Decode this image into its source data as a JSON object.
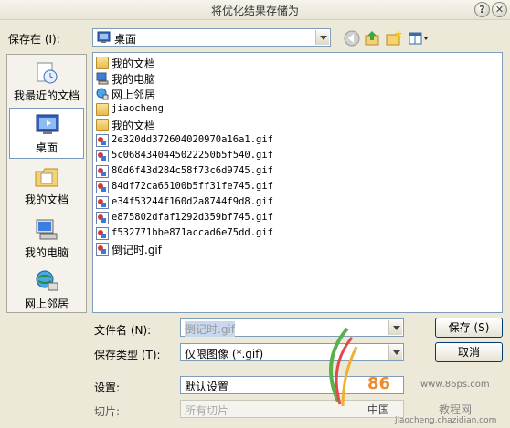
{
  "window": {
    "title": "将优化结果存储为",
    "help_glyph": "?",
    "close_glyph": "✕"
  },
  "toolbar": {
    "save_in_label": "保存在 (I):",
    "location_value": "桌面",
    "icons": [
      "back-icon",
      "up-folder-icon",
      "new-folder-icon",
      "view-menu-icon"
    ]
  },
  "places": [
    {
      "label": "我最近的文档",
      "icon": "recent-documents-icon"
    },
    {
      "label": "桌面",
      "icon": "desktop-icon",
      "selected": true
    },
    {
      "label": "我的文档",
      "icon": "my-documents-icon"
    },
    {
      "label": "我的电脑",
      "icon": "my-computer-icon"
    },
    {
      "label": "网上邻居",
      "icon": "network-places-icon"
    }
  ],
  "files": [
    {
      "name": "我的文档",
      "icon": "documents-folder-icon"
    },
    {
      "name": "我的电脑",
      "icon": "computer-icon"
    },
    {
      "name": "网上邻居",
      "icon": "network-icon"
    },
    {
      "name": "jiaocheng",
      "icon": "folder-icon"
    },
    {
      "name": "我的文档",
      "icon": "folder-icon"
    },
    {
      "name": "2e320dd372604020970a16a1.gif",
      "icon": "gif-file-icon"
    },
    {
      "name": "5c0684340445022250b5f540.gif",
      "icon": "gif-file-icon"
    },
    {
      "name": "80d6f43d284c58f73c6d9745.gif",
      "icon": "gif-file-icon"
    },
    {
      "name": "84df72ca65100b5ff31fe745.gif",
      "icon": "gif-file-icon"
    },
    {
      "name": "e34f53244f160d2a8744f9d8.gif",
      "icon": "gif-file-icon"
    },
    {
      "name": "e875802dfaf1292d359bf745.gif",
      "icon": "gif-file-icon"
    },
    {
      "name": "f532771bbe871accad6e75dd.gif",
      "icon": "gif-file-icon"
    },
    {
      "name": "倒记时.gif",
      "icon": "gif-file-icon"
    }
  ],
  "form": {
    "filename_label": "文件名 (N):",
    "filename_value": "倒记时.gif",
    "filetype_label": "保存类型 (T):",
    "filetype_value": "仅限图像 (*.gif)",
    "settings_label": "设置:",
    "settings_value": "默认设置",
    "slices_label": "切片:",
    "slices_value": "所有切片"
  },
  "buttons": {
    "save": "保存 (S)",
    "cancel": "取消"
  },
  "watermark": {
    "site": "www.86ps.com",
    "logo_text": "86",
    "org": "中国",
    "suffix": "教程网",
    "sub": "jiaocheng.chazidian.com"
  },
  "colors": {
    "dialog_bg": "#ece9d8",
    "field_border": "#7f9db9",
    "button_border": "#003c74"
  }
}
